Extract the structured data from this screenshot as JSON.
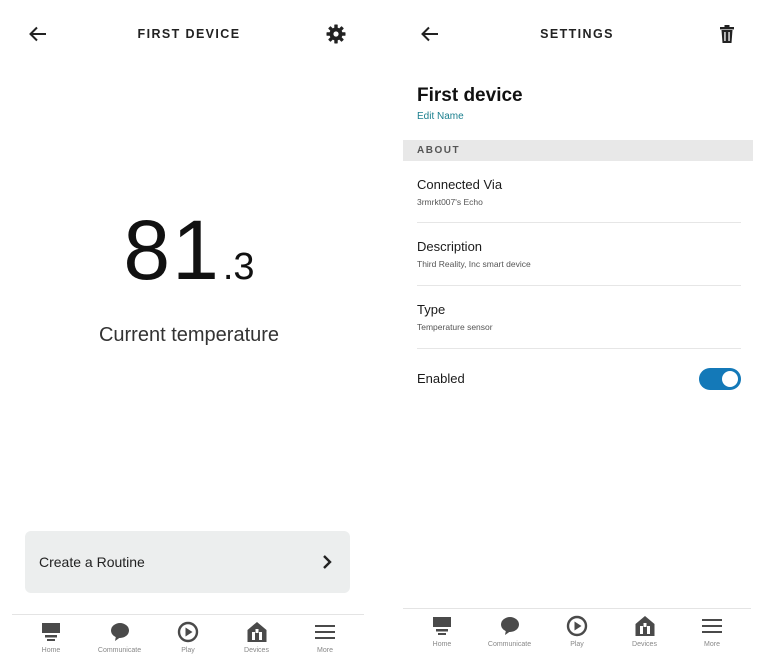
{
  "left": {
    "header": {
      "title": "FIRST DEVICE",
      "back_icon": "arrow-left-icon",
      "settings_icon": "gear-icon"
    },
    "temperature": {
      "integer": "81",
      "decimal": ".3",
      "label": "Current temperature"
    },
    "routine": {
      "label": "Create a Routine",
      "icon": "chevron-right-icon"
    }
  },
  "right": {
    "header": {
      "title": "SETTINGS",
      "back_icon": "arrow-left-icon",
      "delete_icon": "trash-icon"
    },
    "device": {
      "name": "First device",
      "edit_label": "Edit Name"
    },
    "section_about": "ABOUT",
    "rows": [
      {
        "title": "Connected Via",
        "value": "3rmrkt007's Echo"
      },
      {
        "title": "Description",
        "value": "Third Reality, Inc smart device"
      },
      {
        "title": "Type",
        "value": "Temperature sensor"
      }
    ],
    "enabled": {
      "label": "Enabled",
      "on": true
    }
  },
  "nav": {
    "items": [
      {
        "label": "Home",
        "icon": "home-icon"
      },
      {
        "label": "Communicate",
        "icon": "chat-bubble-icon"
      },
      {
        "label": "Play",
        "icon": "play-icon"
      },
      {
        "label": "Devices",
        "icon": "devices-home-icon"
      },
      {
        "label": "More",
        "icon": "menu-icon"
      }
    ]
  },
  "colors": {
    "accent": "#1479b8",
    "link": "#1a7f8e",
    "nav_icon": "#4a4a4a",
    "panel": "#eceeee"
  }
}
